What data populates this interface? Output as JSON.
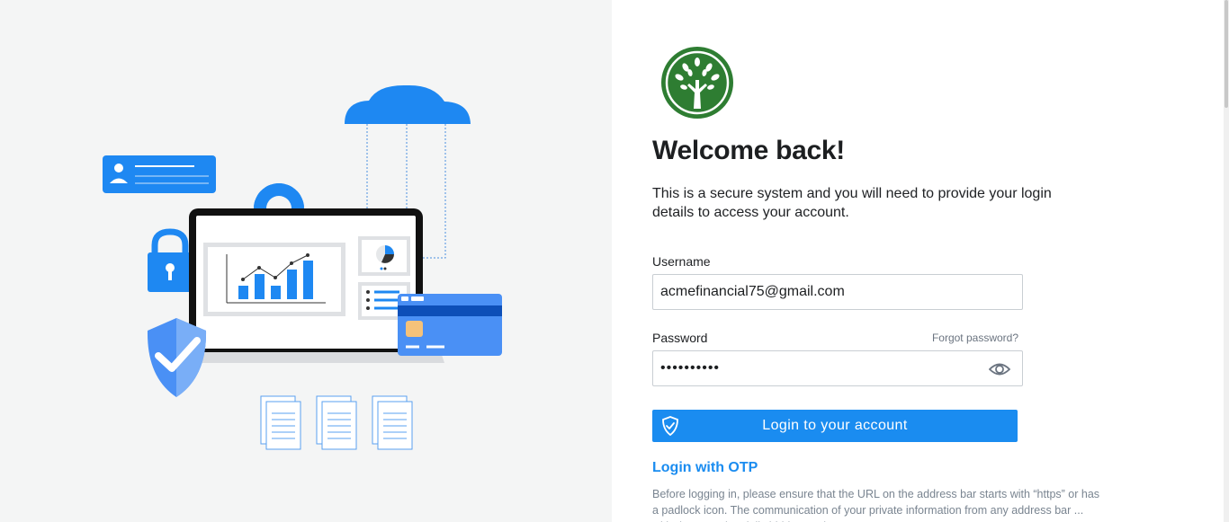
{
  "login": {
    "title": "Welcome back!",
    "subtitle": "This is a secure system and you will need to provide your login details to access your account.",
    "username_label": "Username",
    "username_value": "acmefinancial75@gmail.com",
    "password_label": "Password",
    "password_value": "••••••••••",
    "forgot_password": "Forgot password?",
    "login_button": "Login to your account",
    "otp_link": "Login with OTP",
    "notice": "Before logging in, please ensure that the URL on the address bar starts with “https” or has a padlock icon. The communication of your private information from any address bar ... with \"https\" ... (partially hidden text)"
  },
  "icons": {
    "logo": "tree-logo-icon",
    "eye": "eye-icon",
    "button_shield": "shield-check-icon",
    "illustration": [
      "cloud-icon",
      "user-card-icon",
      "gear-icon",
      "padlock-icon",
      "shield-check-icon",
      "laptop-icon",
      "bar-chart-icon",
      "donut-chart-icon",
      "credit-card-icon",
      "document-icon"
    ]
  },
  "colors": {
    "accent": "#1a8cf0",
    "logo_green": "#2e7d32",
    "left_bg": "#f4f5f5"
  }
}
